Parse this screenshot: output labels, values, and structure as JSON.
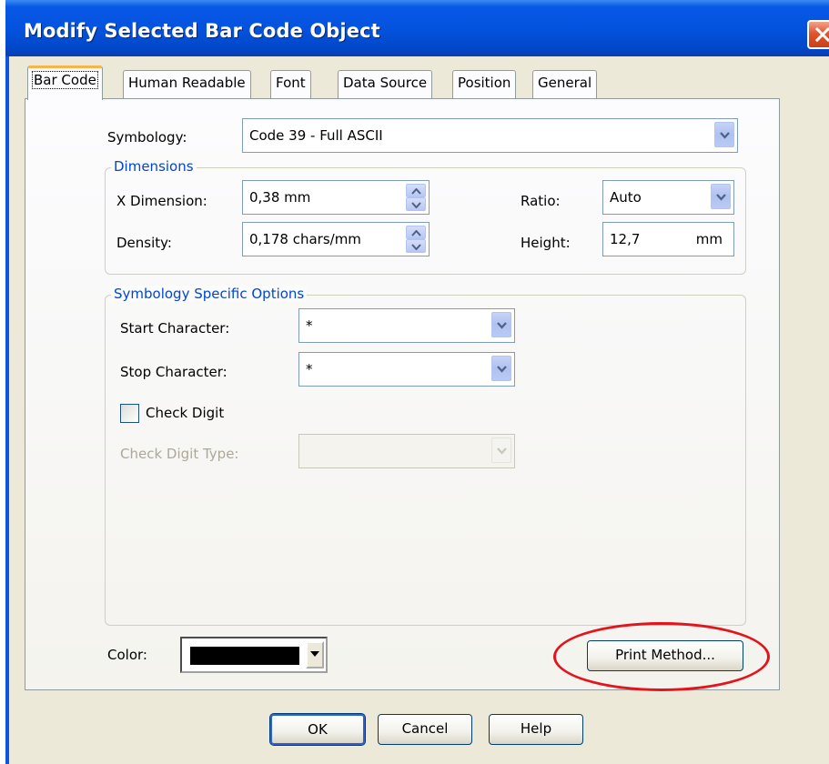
{
  "window": {
    "title": "Modify Selected Bar Code Object",
    "close_label": "Close"
  },
  "tabs": [
    {
      "label": "Bar Code",
      "active": true
    },
    {
      "label": "Human Readable",
      "active": false
    },
    {
      "label": "Font",
      "active": false
    },
    {
      "label": "Data Source",
      "active": false
    },
    {
      "label": "Position",
      "active": false
    },
    {
      "label": "General",
      "active": false
    }
  ],
  "symbology": {
    "label": "Symbology:",
    "value": "Code 39 - Full ASCII"
  },
  "dimensions": {
    "title": "Dimensions",
    "x_dimension": {
      "label": "X Dimension:",
      "value": "0,38  mm"
    },
    "density": {
      "label": "Density:",
      "value": "0,178  chars/mm"
    },
    "ratio": {
      "label": "Ratio:",
      "value": "Auto"
    },
    "height": {
      "label": "Height:",
      "value": "12,7",
      "unit": "mm"
    }
  },
  "options": {
    "title": "Symbology Specific Options",
    "start_character": {
      "label": "Start Character:",
      "value": "*"
    },
    "stop_character": {
      "label": "Stop Character:",
      "value": "*"
    },
    "check_digit": {
      "label": "Check Digit",
      "checked": false
    },
    "check_digit_type": {
      "label": "Check Digit Type:",
      "value": "",
      "enabled": false
    }
  },
  "color": {
    "label": "Color:",
    "value": "#000000"
  },
  "print_method_button": "Print Method...",
  "buttons": {
    "ok": "OK",
    "cancel": "Cancel",
    "help": "Help"
  },
  "annotation": {
    "shape": "ellipse",
    "color": "#e2141c",
    "target": "print-method-button"
  },
  "colors": {
    "titlebar": "#0453df",
    "face": "#ece9d8",
    "group_title": "#0046d5",
    "active_tab_accent": "#f8b34b"
  }
}
